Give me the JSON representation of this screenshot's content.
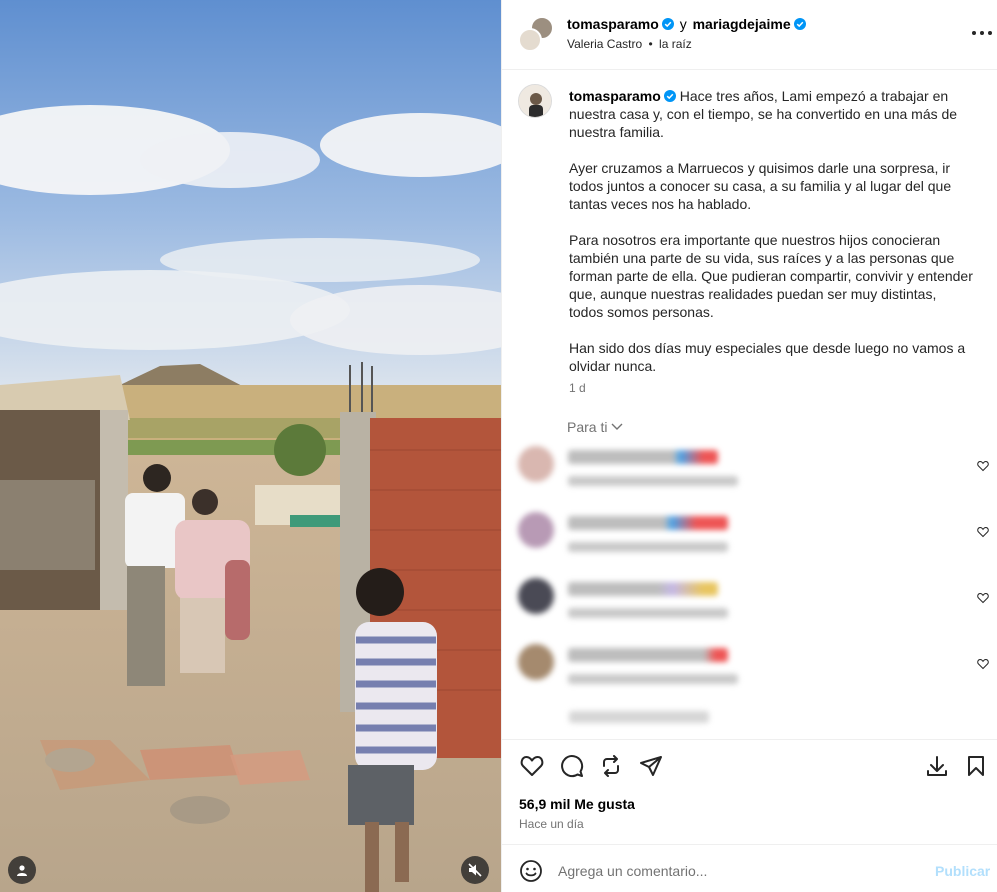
{
  "post": {
    "author": "tomasparamo",
    "connector": "y",
    "coauthor": "mariagdejaime",
    "location_person": "Valeria Castro",
    "separator": "•",
    "audio": "la raíz"
  },
  "caption": {
    "username": "tomasparamo",
    "paragraph1": "Hace tres años, Lami empezó a trabajar en nuestra casa y, con el tiempo, se ha convertido en una más de nuestra familia.",
    "paragraph2": "Ayer cruzamos a Marruecos y quisimos darle una sorpresa, ir todos juntos a conocer su casa, a su familia y al lugar del que tantas veces nos ha hablado.",
    "paragraph3": "Para nosotros era importante que nuestros hijos conocieran también una parte de su vida, sus raíces y a las personas que forman parte de ella. Que pudieran compartir, convivir y entender que, aunque nuestras realidades puedan ser muy distintas, todos somos personas.",
    "paragraph4": "Han sido dos días muy especiales que desde luego no vamos a olvidar nunca.",
    "time": "1 d"
  },
  "comments_filter": "Para ti",
  "comments": [
    {
      "avatar_color": "#d9b7b0"
    },
    {
      "avatar_color": "#b89ab5"
    },
    {
      "avatar_color": "#4a4a55"
    },
    {
      "avatar_color": "#a58a6e"
    }
  ],
  "stats": {
    "likes": "56,9 mil Me gusta",
    "posted": "Hace un día"
  },
  "composer": {
    "placeholder": "Agrega un comentario...",
    "publish": "Publicar"
  },
  "colors": {
    "verified": "#0095f6",
    "publish_disabled": "#b2dffc",
    "secondary_text": "#737373"
  }
}
